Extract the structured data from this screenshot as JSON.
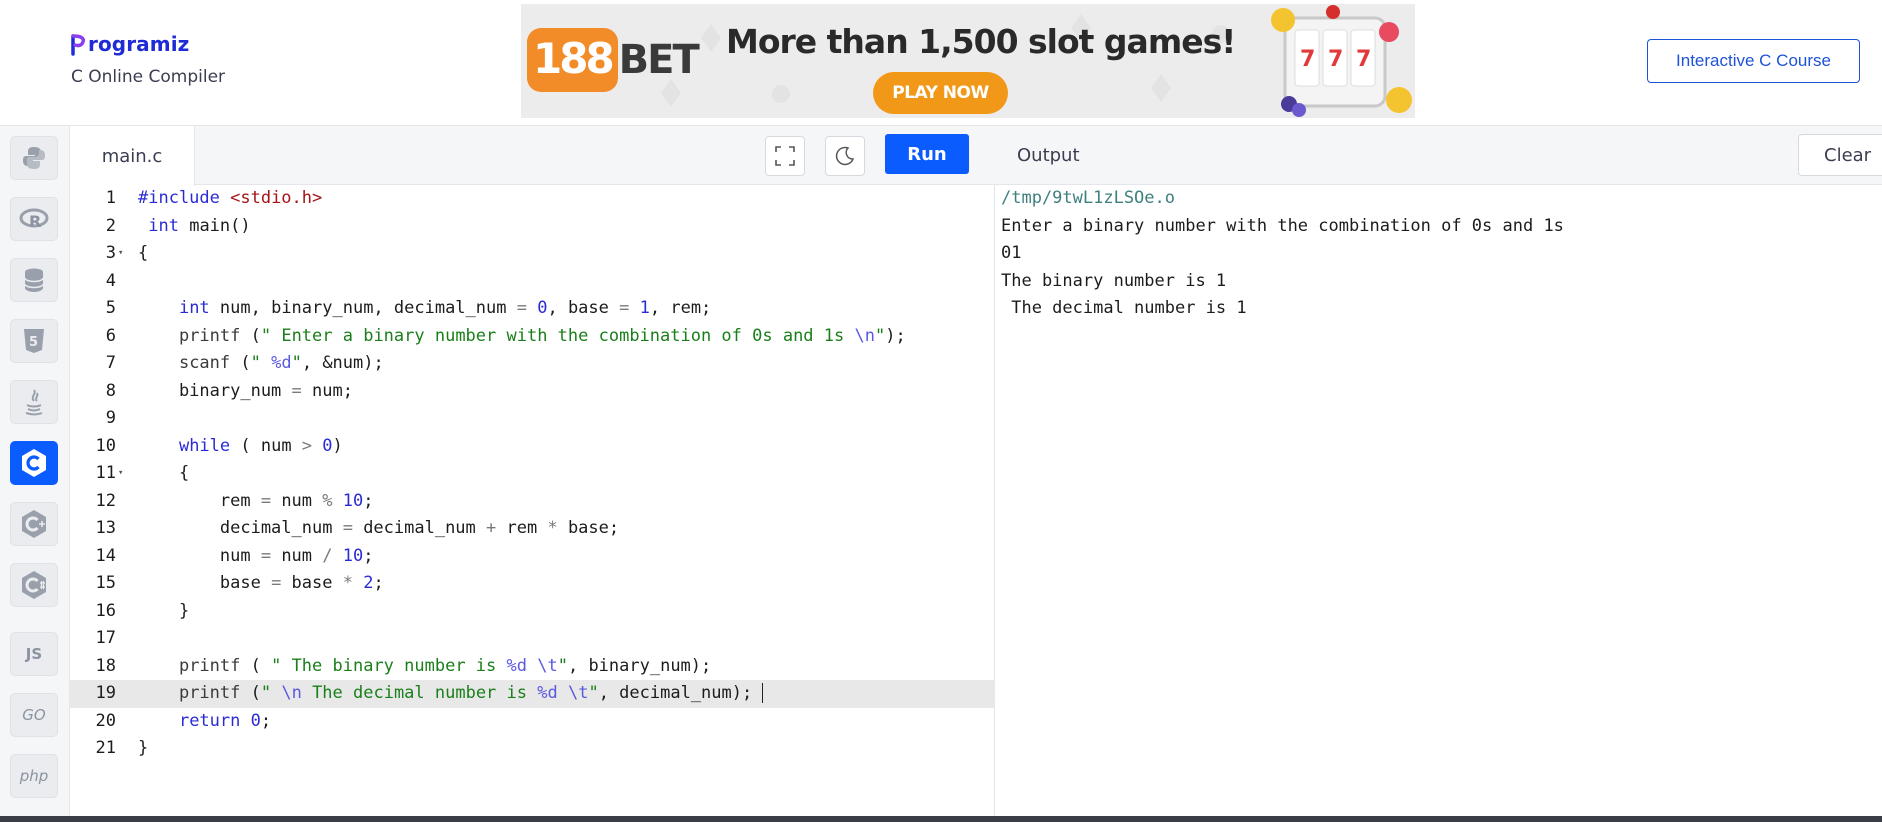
{
  "header": {
    "logo_text": "rogramiz",
    "subtitle": "C Online Compiler",
    "course_button": "Interactive C Course"
  },
  "ad": {
    "logo_number": "188",
    "logo_word": "BET",
    "headline": "More than 1,500 slot games!",
    "cta": "PLAY NOW"
  },
  "sidebar": {
    "languages": [
      {
        "name": "python",
        "label": ""
      },
      {
        "name": "r",
        "label": ""
      },
      {
        "name": "sql",
        "label": ""
      },
      {
        "name": "html",
        "label": ""
      },
      {
        "name": "java",
        "label": ""
      },
      {
        "name": "c",
        "label": "",
        "active": true
      },
      {
        "name": "cpp",
        "label": ""
      },
      {
        "name": "csharp",
        "label": ""
      },
      {
        "name": "js",
        "label": "JS"
      },
      {
        "name": "go",
        "label": "GO"
      },
      {
        "name": "php",
        "label": "php"
      }
    ]
  },
  "editor": {
    "tab_name": "main.c",
    "run_label": "Run",
    "current_line": 19,
    "lines": [
      "#include <stdio.h>",
      " int main()",
      "{",
      "    ",
      "    int num, binary_num, decimal_num = 0, base = 1, rem;",
      "    printf (\" Enter a binary number with the combination of 0s and 1s \\n\");",
      "    scanf (\" %d\", &num);",
      "    binary_num = num;",
      "    ",
      "    while ( num > 0)",
      "    {",
      "        rem = num % 10;",
      "        decimal_num = decimal_num + rem * base;",
      "        num = num / 10;",
      "        base = base * 2;",
      "    }",
      "",
      "    printf ( \" The binary number is %d \\t\", binary_num);",
      "    printf (\" \\n The decimal number is %d \\t\", decimal_num);",
      "    return 0;",
      "}"
    ]
  },
  "output": {
    "title": "Output",
    "clear_label": "Clear",
    "lines": [
      "/tmp/9twL1zLSOe.o",
      "Enter a binary number with the combination of 0s and 1s",
      "01",
      "The binary number is 1",
      " The decimal number is 1"
    ]
  }
}
